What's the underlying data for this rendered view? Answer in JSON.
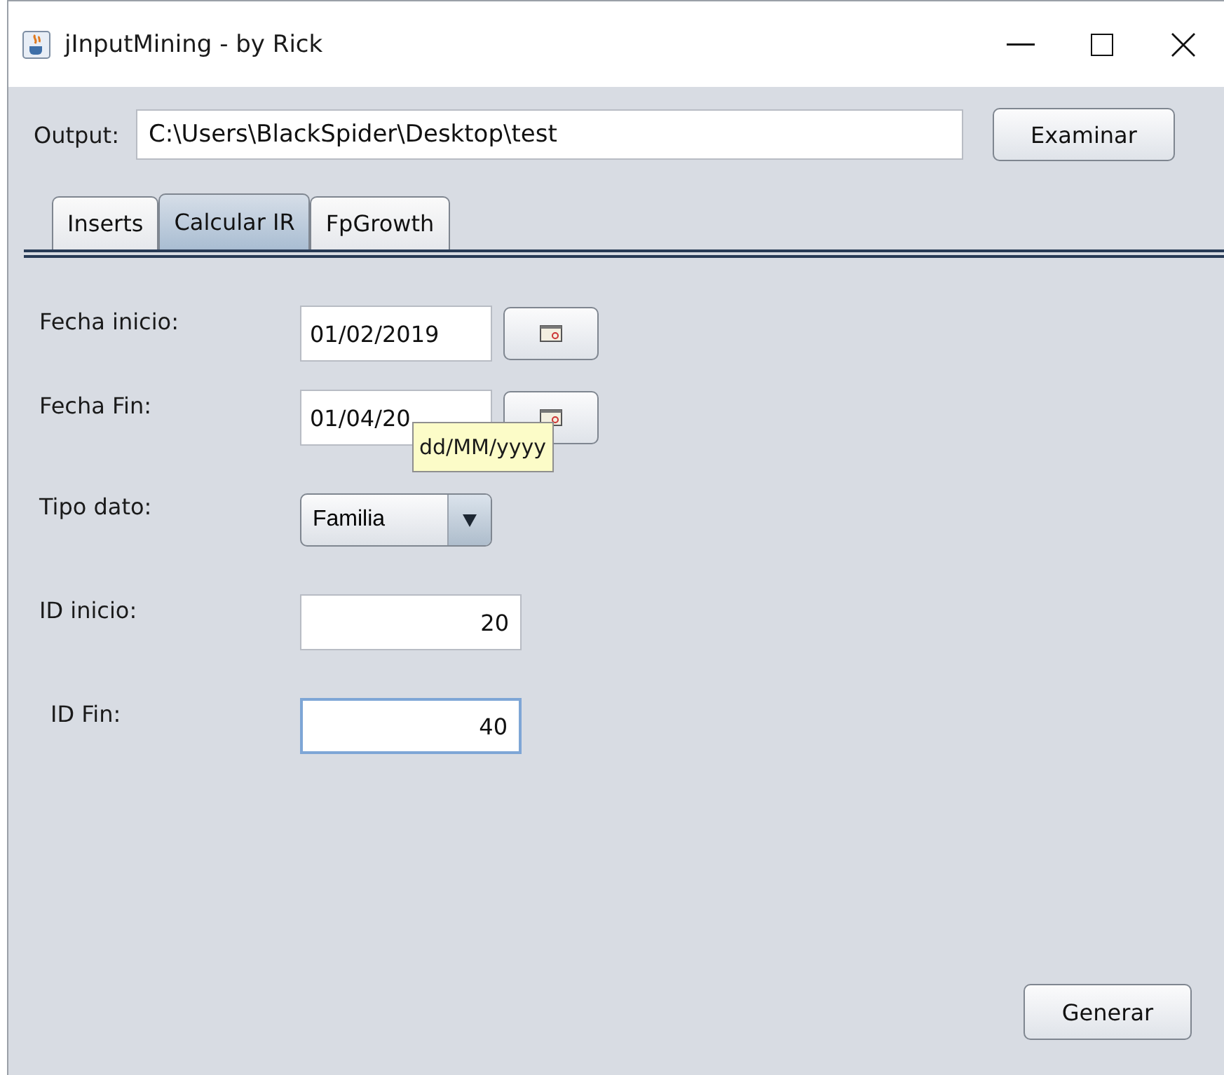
{
  "window": {
    "title": "jInputMining - by Rick"
  },
  "output": {
    "label": "Output:",
    "value": "C:\\Users\\BlackSpider\\Desktop\\test",
    "button": "Examinar"
  },
  "tabs": [
    {
      "label": "Inserts",
      "selected": false
    },
    {
      "label": "Calcular IR",
      "selected": true
    },
    {
      "label": "FpGrowth",
      "selected": false
    }
  ],
  "form": [
    {
      "kind": "date",
      "label": "Fecha inicio:",
      "value": "01/02/2019",
      "focused": false
    },
    {
      "kind": "date",
      "label": "Fecha Fin:",
      "value": "01/04/20",
      "focused": false
    },
    {
      "kind": "combo",
      "label": "Tipo dato:",
      "value": "Familia"
    },
    {
      "kind": "number",
      "label": "ID inicio:",
      "value": "20",
      "focused": false
    },
    {
      "kind": "number",
      "label": "ID Fin:",
      "value": "40",
      "focused": true
    }
  ],
  "tooltip": {
    "text": "dd/MM/yyyy"
  },
  "generate_button": "Generar"
}
